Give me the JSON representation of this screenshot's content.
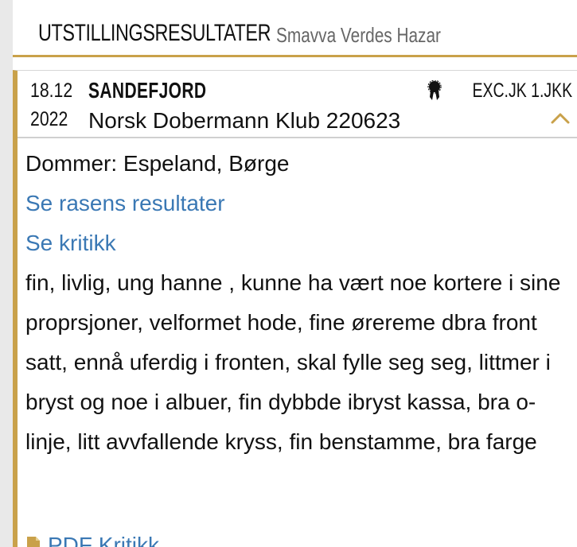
{
  "header": {
    "title": "UTSTILLINGSRESULTATER",
    "dog_name": "Smavva Verdes Hazar"
  },
  "result": {
    "date_day": "18.12",
    "date_year": "2022",
    "place": "SANDEFJORD",
    "club": "Norsk Dobermann Klub 220623",
    "award_icon": "rosette-icon",
    "award": "EXC.JK 1.JKK",
    "toggle_icon": "chevron-up-icon",
    "judge": "Dommer: Espeland, Børge",
    "breed_results_link": "Se rasens resultater",
    "critique_link": "Se kritikk",
    "critique_text": "fin, livlig, ung hanne , kunne ha vært noe kortere i sine proprsjoner, velformet hode, fine ørereme dbra front satt, ennå uferdig i fronten, skal fylle seg seg, littmer i bryst og noe i albuer, fin dybbde ibryst kassa, bra o-linje, litt avvfallende kryss, fin benstamme, bra farge",
    "pdf_icon": "pdf-icon",
    "pdf_link": "PDF Kritikk"
  },
  "colors": {
    "accent": "#c9a14a",
    "link": "#3a78b4",
    "text": "#111111",
    "muted": "#666666"
  }
}
